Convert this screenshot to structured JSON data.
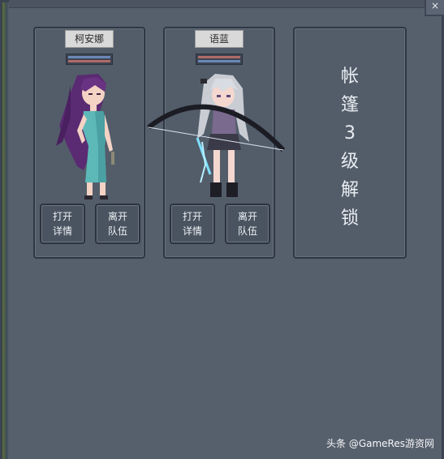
{
  "window": {
    "close_glyph": "×"
  },
  "party": [
    {
      "name": "柯安娜",
      "hp_color": "#6b87b8",
      "mp_color": "#b06a6a",
      "buttons": {
        "details": {
          "line1": "打开",
          "line2": "详情"
        },
        "leave": {
          "line1": "离开",
          "line2": "队伍"
        }
      }
    },
    {
      "name": "语蓝",
      "hp_color": "#b06a6a",
      "mp_color": "#6b87b8",
      "buttons": {
        "details": {
          "line1": "打开",
          "line2": "详情"
        },
        "leave": {
          "line1": "离开",
          "line2": "队伍"
        }
      }
    }
  ],
  "locked_slot": {
    "chars": [
      "帐",
      "篷",
      "3",
      "级",
      "解",
      "锁"
    ]
  },
  "watermark": "头条 @GameRes游资网"
}
